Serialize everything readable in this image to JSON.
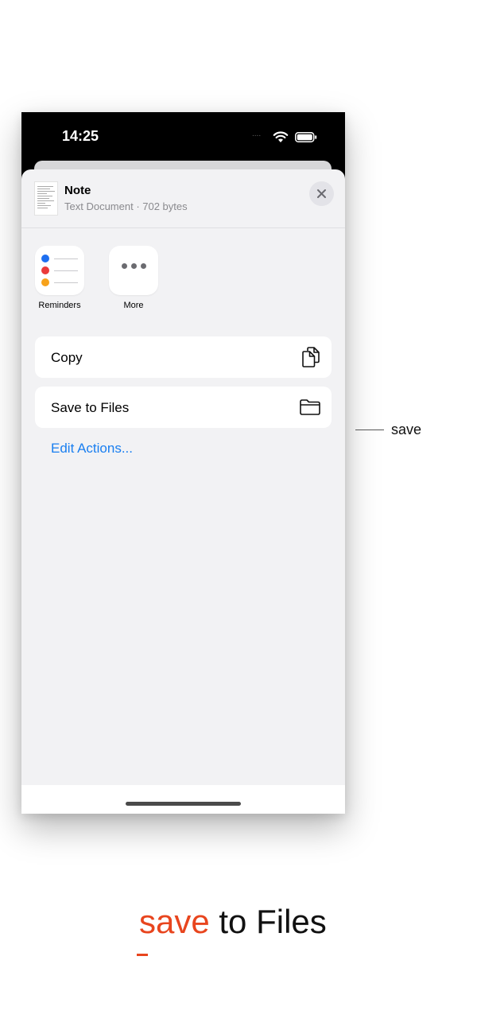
{
  "status_bar": {
    "time": "14:25",
    "signal_indicator": "....",
    "wifi_icon": "wifi-icon",
    "battery_icon": "battery-icon"
  },
  "share_sheet": {
    "document": {
      "title": "Note",
      "subtitle": "Text Document · 702 bytes",
      "thumbnail_icon": "text-document-thumbnail"
    },
    "close_icon": "close-icon",
    "apps": [
      {
        "label": "Reminders",
        "icon": "reminders-icon"
      },
      {
        "label": "More",
        "icon": "more-icon"
      }
    ],
    "actions": [
      {
        "label": "Copy",
        "icon": "copy-icon"
      },
      {
        "label": "Save to Files",
        "icon": "folder-icon"
      }
    ],
    "edit_actions_label": "Edit Actions..."
  },
  "annotation": {
    "callout_label": "save"
  },
  "caption": {
    "accent_word": "save",
    "rest": " to Files"
  },
  "colors": {
    "accent": "#e8451e",
    "link_blue": "#1a7ff0",
    "sheet_background": "#f2f2f4",
    "reminder_dot_colors": [
      "#1e6ff0",
      "#ea3a3a",
      "#f7a21b"
    ]
  }
}
